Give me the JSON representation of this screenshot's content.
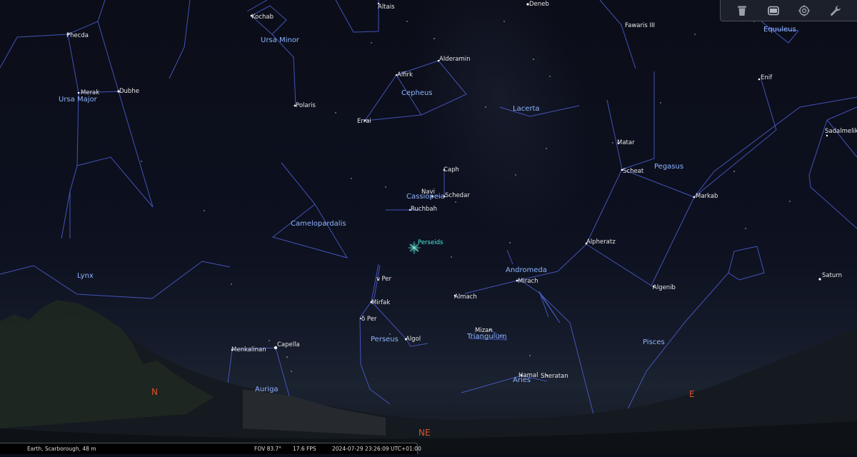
{
  "toolbar": {
    "icons": [
      "trash-icon",
      "window-icon",
      "target-icon",
      "wrench-icon"
    ]
  },
  "status": {
    "location": "Earth, Scarborough, 48 m",
    "fov": "FOV 83.7°",
    "fps": "17.6 FPS",
    "datetime": "2024-07-29 23:26:09 UTC+01:00"
  },
  "cardinals": {
    "n": "N",
    "ne": "NE",
    "e": "E"
  },
  "stars": {
    "kochab": "Kochab",
    "altais": "Altais",
    "deneb": "Deneb",
    "fawaris": "Fawaris III",
    "phecda": "Phecda",
    "merak": "Merak",
    "dubhe": "Dubhe",
    "polaris": "Polaris",
    "alderamin": "Alderamin",
    "alfirk": "Alfirk",
    "errai": "Errai",
    "enif": "Enif",
    "sadalmelik": "Sadalmelik",
    "matar": "Matar",
    "scheat": "Scheat",
    "caph": "Caph",
    "navi": "Navi",
    "schedar": "Schedar",
    "ruchbah": "Ruchbah",
    "markab": "Markab",
    "alpheratz": "Alpheratz",
    "vper": "ν Per",
    "mirach": "Mirach",
    "almach": "Almach",
    "algenib": "Algenib",
    "mirfak": "Mirfak",
    "dper": "δ Per",
    "algol": "Algol",
    "mizan": "Mizan",
    "capella": "Capella",
    "menkalinan": "Menkalinan",
    "hamal": "Hamal",
    "sheratan": "Sheratan"
  },
  "constellations": {
    "ursa_minor": "Ursa Minor",
    "ursa_major": "Ursa Major",
    "cepheus": "Cepheus",
    "lacerta": "Lacerta",
    "equuleus": "Equuleus",
    "pegasus": "Pegasus",
    "cassiopeia": "Cassiopeia",
    "camelopardalis": "Camelopardalis",
    "lynx": "Lynx",
    "andromeda": "Andromeda",
    "perseus": "Perseus",
    "triangulum": "Triangulum",
    "pisces": "Pisces",
    "auriga": "Auriga",
    "aries": "Aries"
  },
  "meteor_shower": "Perseids",
  "planet": "Saturn"
}
